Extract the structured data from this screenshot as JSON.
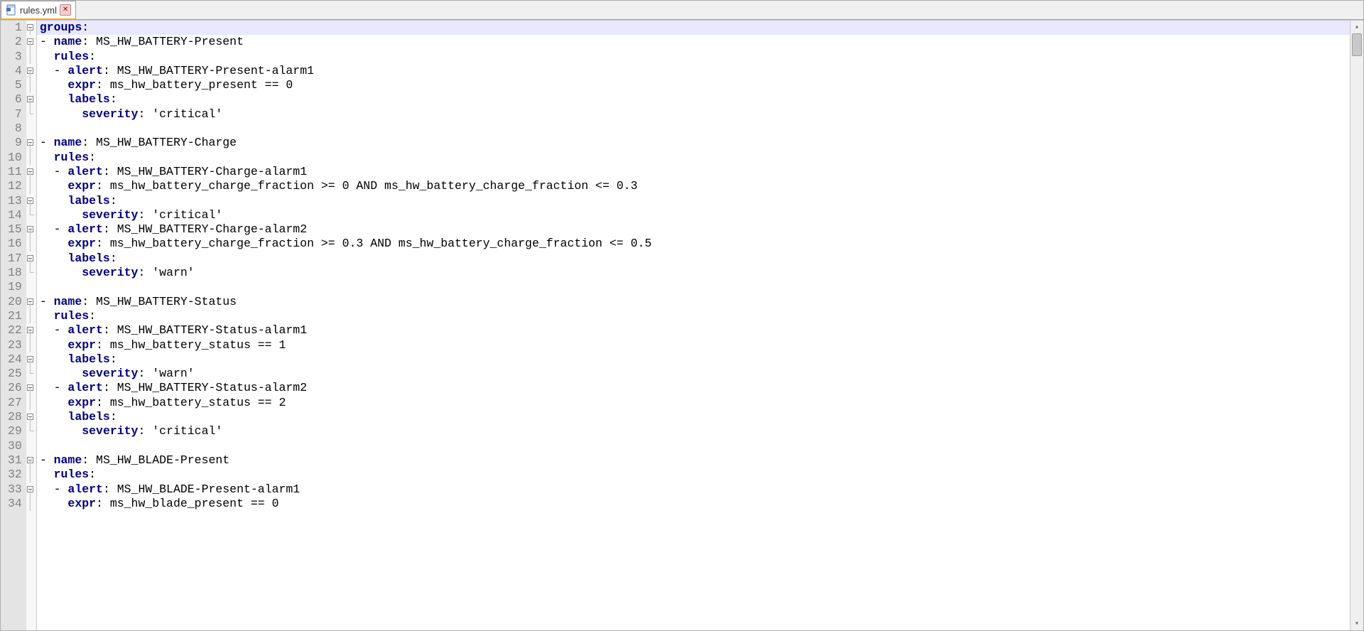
{
  "tab": {
    "label": "rules.yml"
  },
  "code": {
    "lines": [
      {
        "n": 1,
        "fold": "open",
        "hl": true,
        "segs": [
          {
            "c": "tok-key",
            "t": "groups"
          },
          {
            "c": "tok-op",
            "t": ":"
          }
        ],
        "caret": true
      },
      {
        "n": 2,
        "fold": "open",
        "segs": [
          {
            "c": "tok-plain",
            "t": "- "
          },
          {
            "c": "tok-key",
            "t": "name"
          },
          {
            "c": "tok-op",
            "t": ": "
          },
          {
            "c": "tok-plain",
            "t": "MS_HW_BATTERY-Present"
          }
        ]
      },
      {
        "n": 3,
        "fold": "line",
        "segs": [
          {
            "c": "tok-plain",
            "t": "  "
          },
          {
            "c": "tok-key",
            "t": "rules"
          },
          {
            "c": "tok-op",
            "t": ":"
          }
        ]
      },
      {
        "n": 4,
        "fold": "open",
        "segs": [
          {
            "c": "tok-plain",
            "t": "  - "
          },
          {
            "c": "tok-key",
            "t": "alert"
          },
          {
            "c": "tok-op",
            "t": ": "
          },
          {
            "c": "tok-plain",
            "t": "MS_HW_BATTERY-Present-alarm1"
          }
        ]
      },
      {
        "n": 5,
        "fold": "line",
        "segs": [
          {
            "c": "tok-plain",
            "t": "    "
          },
          {
            "c": "tok-key",
            "t": "expr"
          },
          {
            "c": "tok-op",
            "t": ": "
          },
          {
            "c": "tok-plain",
            "t": "ms_hw_battery_present == 0"
          }
        ]
      },
      {
        "n": 6,
        "fold": "open",
        "segs": [
          {
            "c": "tok-plain",
            "t": "    "
          },
          {
            "c": "tok-key",
            "t": "labels"
          },
          {
            "c": "tok-op",
            "t": ":"
          }
        ]
      },
      {
        "n": 7,
        "fold": "end",
        "segs": [
          {
            "c": "tok-plain",
            "t": "      "
          },
          {
            "c": "tok-key",
            "t": "severity"
          },
          {
            "c": "tok-op",
            "t": ": "
          },
          {
            "c": "tok-str",
            "t": "'critical'"
          }
        ]
      },
      {
        "n": 8,
        "fold": "none",
        "segs": []
      },
      {
        "n": 9,
        "fold": "open",
        "segs": [
          {
            "c": "tok-plain",
            "t": "- "
          },
          {
            "c": "tok-key",
            "t": "name"
          },
          {
            "c": "tok-op",
            "t": ": "
          },
          {
            "c": "tok-plain",
            "t": "MS_HW_BATTERY-Charge"
          }
        ]
      },
      {
        "n": 10,
        "fold": "line",
        "segs": [
          {
            "c": "tok-plain",
            "t": "  "
          },
          {
            "c": "tok-key",
            "t": "rules"
          },
          {
            "c": "tok-op",
            "t": ":"
          }
        ]
      },
      {
        "n": 11,
        "fold": "open",
        "segs": [
          {
            "c": "tok-plain",
            "t": "  - "
          },
          {
            "c": "tok-key",
            "t": "alert"
          },
          {
            "c": "tok-op",
            "t": ": "
          },
          {
            "c": "tok-plain",
            "t": "MS_HW_BATTERY-Charge-alarm1"
          }
        ]
      },
      {
        "n": 12,
        "fold": "line",
        "segs": [
          {
            "c": "tok-plain",
            "t": "    "
          },
          {
            "c": "tok-key",
            "t": "expr"
          },
          {
            "c": "tok-op",
            "t": ": "
          },
          {
            "c": "tok-plain",
            "t": "ms_hw_battery_charge_fraction >= 0 AND ms_hw_battery_charge_fraction <= 0.3"
          }
        ]
      },
      {
        "n": 13,
        "fold": "open",
        "segs": [
          {
            "c": "tok-plain",
            "t": "    "
          },
          {
            "c": "tok-key",
            "t": "labels"
          },
          {
            "c": "tok-op",
            "t": ":"
          }
        ]
      },
      {
        "n": 14,
        "fold": "end",
        "segs": [
          {
            "c": "tok-plain",
            "t": "      "
          },
          {
            "c": "tok-key",
            "t": "severity"
          },
          {
            "c": "tok-op",
            "t": ": "
          },
          {
            "c": "tok-str",
            "t": "'critical'"
          }
        ]
      },
      {
        "n": 15,
        "fold": "open",
        "segs": [
          {
            "c": "tok-plain",
            "t": "  - "
          },
          {
            "c": "tok-key",
            "t": "alert"
          },
          {
            "c": "tok-op",
            "t": ": "
          },
          {
            "c": "tok-plain",
            "t": "MS_HW_BATTERY-Charge-alarm2"
          }
        ]
      },
      {
        "n": 16,
        "fold": "line",
        "segs": [
          {
            "c": "tok-plain",
            "t": "    "
          },
          {
            "c": "tok-key",
            "t": "expr"
          },
          {
            "c": "tok-op",
            "t": ": "
          },
          {
            "c": "tok-plain",
            "t": "ms_hw_battery_charge_fraction >= 0.3 AND ms_hw_battery_charge_fraction <= 0.5"
          }
        ]
      },
      {
        "n": 17,
        "fold": "open",
        "segs": [
          {
            "c": "tok-plain",
            "t": "    "
          },
          {
            "c": "tok-key",
            "t": "labels"
          },
          {
            "c": "tok-op",
            "t": ":"
          }
        ]
      },
      {
        "n": 18,
        "fold": "end",
        "segs": [
          {
            "c": "tok-plain",
            "t": "      "
          },
          {
            "c": "tok-key",
            "t": "severity"
          },
          {
            "c": "tok-op",
            "t": ": "
          },
          {
            "c": "tok-str",
            "t": "'warn'"
          }
        ]
      },
      {
        "n": 19,
        "fold": "none",
        "segs": []
      },
      {
        "n": 20,
        "fold": "open",
        "segs": [
          {
            "c": "tok-plain",
            "t": "- "
          },
          {
            "c": "tok-key",
            "t": "name"
          },
          {
            "c": "tok-op",
            "t": ": "
          },
          {
            "c": "tok-plain",
            "t": "MS_HW_BATTERY-Status"
          }
        ]
      },
      {
        "n": 21,
        "fold": "line",
        "segs": [
          {
            "c": "tok-plain",
            "t": "  "
          },
          {
            "c": "tok-key",
            "t": "rules"
          },
          {
            "c": "tok-op",
            "t": ":"
          }
        ]
      },
      {
        "n": 22,
        "fold": "open",
        "segs": [
          {
            "c": "tok-plain",
            "t": "  - "
          },
          {
            "c": "tok-key",
            "t": "alert"
          },
          {
            "c": "tok-op",
            "t": ": "
          },
          {
            "c": "tok-plain",
            "t": "MS_HW_BATTERY-Status-alarm1"
          }
        ]
      },
      {
        "n": 23,
        "fold": "line",
        "segs": [
          {
            "c": "tok-plain",
            "t": "    "
          },
          {
            "c": "tok-key",
            "t": "expr"
          },
          {
            "c": "tok-op",
            "t": ": "
          },
          {
            "c": "tok-plain",
            "t": "ms_hw_battery_status == 1"
          }
        ]
      },
      {
        "n": 24,
        "fold": "open",
        "segs": [
          {
            "c": "tok-plain",
            "t": "    "
          },
          {
            "c": "tok-key",
            "t": "labels"
          },
          {
            "c": "tok-op",
            "t": ":"
          }
        ]
      },
      {
        "n": 25,
        "fold": "end",
        "segs": [
          {
            "c": "tok-plain",
            "t": "      "
          },
          {
            "c": "tok-key",
            "t": "severity"
          },
          {
            "c": "tok-op",
            "t": ": "
          },
          {
            "c": "tok-str",
            "t": "'warn'"
          }
        ]
      },
      {
        "n": 26,
        "fold": "open",
        "segs": [
          {
            "c": "tok-plain",
            "t": "  - "
          },
          {
            "c": "tok-key",
            "t": "alert"
          },
          {
            "c": "tok-op",
            "t": ": "
          },
          {
            "c": "tok-plain",
            "t": "MS_HW_BATTERY-Status-alarm2"
          }
        ]
      },
      {
        "n": 27,
        "fold": "line",
        "segs": [
          {
            "c": "tok-plain",
            "t": "    "
          },
          {
            "c": "tok-key",
            "t": "expr"
          },
          {
            "c": "tok-op",
            "t": ": "
          },
          {
            "c": "tok-plain",
            "t": "ms_hw_battery_status == 2"
          }
        ]
      },
      {
        "n": 28,
        "fold": "open",
        "segs": [
          {
            "c": "tok-plain",
            "t": "    "
          },
          {
            "c": "tok-key",
            "t": "labels"
          },
          {
            "c": "tok-op",
            "t": ":"
          }
        ]
      },
      {
        "n": 29,
        "fold": "end",
        "segs": [
          {
            "c": "tok-plain",
            "t": "      "
          },
          {
            "c": "tok-key",
            "t": "severity"
          },
          {
            "c": "tok-op",
            "t": ": "
          },
          {
            "c": "tok-str",
            "t": "'critical'"
          }
        ]
      },
      {
        "n": 30,
        "fold": "none",
        "segs": []
      },
      {
        "n": 31,
        "fold": "open",
        "segs": [
          {
            "c": "tok-plain",
            "t": "- "
          },
          {
            "c": "tok-key",
            "t": "name"
          },
          {
            "c": "tok-op",
            "t": ": "
          },
          {
            "c": "tok-plain",
            "t": "MS_HW_BLADE-Present"
          }
        ]
      },
      {
        "n": 32,
        "fold": "line",
        "segs": [
          {
            "c": "tok-plain",
            "t": "  "
          },
          {
            "c": "tok-key",
            "t": "rules"
          },
          {
            "c": "tok-op",
            "t": ":"
          }
        ]
      },
      {
        "n": 33,
        "fold": "open",
        "segs": [
          {
            "c": "tok-plain",
            "t": "  - "
          },
          {
            "c": "tok-key",
            "t": "alert"
          },
          {
            "c": "tok-op",
            "t": ": "
          },
          {
            "c": "tok-plain",
            "t": "MS_HW_BLADE-Present-alarm1"
          }
        ]
      },
      {
        "n": 34,
        "fold": "line",
        "segs": [
          {
            "c": "tok-plain",
            "t": "    "
          },
          {
            "c": "tok-key",
            "t": "expr"
          },
          {
            "c": "tok-op",
            "t": ": "
          },
          {
            "c": "tok-plain",
            "t": "ms_hw_blade_present == 0"
          }
        ]
      }
    ]
  }
}
